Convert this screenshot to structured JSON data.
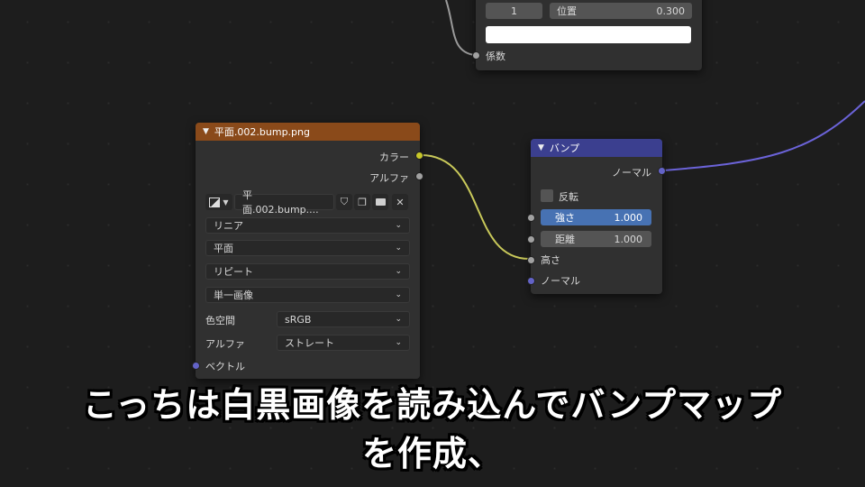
{
  "colorramp_node": {
    "stop_index": "1",
    "position_label": "位置",
    "position_value": "0.300",
    "output_factor": "係数"
  },
  "image_node": {
    "title": "平面.002.bump.png",
    "header_color": "#8a4a1a",
    "outputs": {
      "color": "カラー",
      "alpha": "アルファ"
    },
    "image_name": "平面.002.bump....",
    "interpolation": "リニア",
    "projection": "平面",
    "extension": "リピート",
    "source": "単一画像",
    "colorspace_label": "色空間",
    "colorspace_value": "sRGB",
    "alpha_label": "アルファ",
    "alpha_value": "ストレート",
    "input_vector": "ベクトル"
  },
  "bump_node": {
    "title": "バンプ",
    "header_color": "#3b3f8f",
    "output_normal": "ノーマル",
    "invert_label": "反転",
    "strength_label": "強さ",
    "strength_value": "1.000",
    "distance_label": "距離",
    "distance_value": "1.000",
    "input_height": "高さ",
    "input_normal": "ノーマル"
  },
  "subtitle": {
    "line1": "こっちは白黒画像を読み込んでバンプマップ",
    "line2": "を作成、"
  },
  "colors": {
    "socket_yellow": "#c7c729",
    "socket_grey": "#a1a1a1",
    "socket_purple": "#6363c7",
    "wire_purple": "#6b63d8"
  }
}
